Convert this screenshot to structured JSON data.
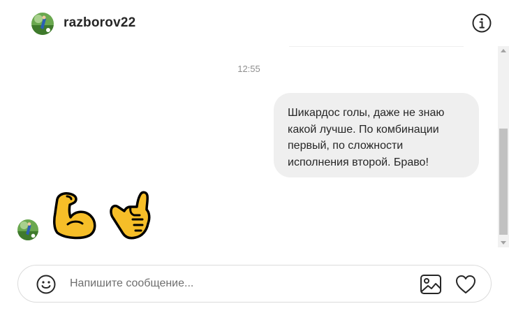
{
  "header": {
    "username": "razborov22",
    "avatar_icon": "profile-avatar",
    "info_icon": "info-icon"
  },
  "thread": {
    "timestamp": "12:55",
    "messages": [
      {
        "direction": "outgoing",
        "lines": [
          "Шикардос голы, даже не знаю",
          "какой лучше. По комбинации",
          "первый, по сложности",
          "исполнения второй. Браво!"
        ]
      },
      {
        "direction": "incoming",
        "emojis": [
          "💪",
          "🤙"
        ],
        "emoji_icons": [
          "flexed-biceps-emoji",
          "call-me-hand-emoji"
        ]
      }
    ]
  },
  "composer": {
    "placeholder": "Напишите сообщение...",
    "value": "",
    "icons": [
      "smiley-icon",
      "image-icon",
      "heart-icon"
    ]
  },
  "colors": {
    "bubble": "#efefef",
    "timestamp": "#8e8e8e",
    "text": "#262626",
    "border": "#dbdbdb",
    "emoji_yellow": "#f6be28"
  }
}
